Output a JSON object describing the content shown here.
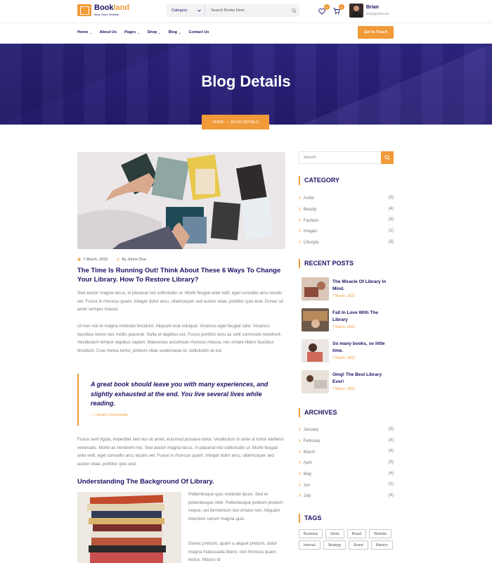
{
  "header": {
    "logo_name_a": "Book",
    "logo_name_b": "land",
    "logo_tagline": "Book Store Website",
    "category_label": "Category",
    "search_placeholder": "Search Books Here",
    "wishlist_count": "0",
    "cart_count": "0",
    "user_name": "Brian",
    "user_email": "info@gmail.com"
  },
  "nav": {
    "items": [
      "Home",
      "About Us",
      "Pages",
      "Shop",
      "Blog",
      "Contact Us"
    ],
    "cta_label": "Get In Touch"
  },
  "hero": {
    "title": "Blog Details",
    "crumb_home": "HOME",
    "crumb_sep": "•",
    "crumb_current": "BLOG DETAILS"
  },
  "post": {
    "date": "7 March, 2022",
    "author": "By Johne Doe",
    "title": "The Time Is Running Out! Think About These 6 Ways To Change Your Library. How To Restore Library?",
    "para1": "Sed auctor magna lacus, in placerat nisl sollicitudin ut. Morbi feugiat ante velit, eget convallis arcu iaculis vel. Fusce in rhoncus quam. Integer dolor arcu, ullamcorper sed auctor vitae, porttitor quis erat. Donec sit amet semper massa.",
    "para2": "Ut non nisl et magna molestie tincidunt. Aliquam erat volutpat. Vivamus eget feugiat odio. Vivamus faucibus lorem nec mollis placerat. Nulla et dapibus est. Fusce porttitor arcu ac velit commodo hendrerit. Vestibulum tempor dapibus sapien. Maecenas accumsan rhoncus massa, nec ornare libero faucibus tincidunt. Cras metus tortor, pretium vitae scelerisque id, sollicitudin at est.",
    "quote": "A great book should leave you with many experiences, and slightly exhausted at the end. You live several lives while reading.",
    "quote_author": "Library Community",
    "para3": "Fusce sem ligula, imperdiet sed nisi sit amet, euismod posuere dolor. Vestibulum in ante ut tortor eleifend venenatis. Morbi ac hendrerit nisl. Sed auctor magna lacus, in placerat nisl sollicitudin ut. Morbi feugiat ante velit, eget convallis arcu iaculis vel. Fusce in rhoncus quam. Integer dolor arcu, ullamcorper sed auctor vitae, porttitor quis erat.",
    "subheading": "Understanding The Background Of Library.",
    "side_para1": "Pellentesque quis molestie lacus. Sed et pellentesque nibh. Pellentesque pretium pretium neque, vel fermentum nisl ornare non. Aliquam interdum rutrum magna quis.",
    "side_para2": "Donec pretium, quam a aliquet pretium, dolor magna malesuada libero, non rhoncus quam lectus. Mauris id"
  },
  "sidebar": {
    "search_placeholder": "Search",
    "category_title": "CATEGORY",
    "categories": [
      {
        "label": "Audio",
        "count": "(3)"
      },
      {
        "label": "Beauty",
        "count": "(4)"
      },
      {
        "label": "Fashion",
        "count": "(3)"
      },
      {
        "label": "Images",
        "count": "(1)"
      },
      {
        "label": "Lifestyle",
        "count": "(3)"
      }
    ],
    "recent_title": "RECENT POSTS",
    "recent_posts": [
      {
        "title": "The Miracle Of Library In Mind.",
        "date": "7 March, 2022"
      },
      {
        "title": "Fall In Love With The Library",
        "date": "7 March, 2022"
      },
      {
        "title": "So many books, so little time.",
        "date": "7 March, 2022"
      },
      {
        "title": "Omg! The Best Library Ever!",
        "date": "7 March, 2022"
      }
    ],
    "archives_title": "ARCHIVES",
    "archives": [
      {
        "label": "January",
        "count": "(3)"
      },
      {
        "label": "February",
        "count": "(4)"
      },
      {
        "label": "March",
        "count": "(4)"
      },
      {
        "label": "April",
        "count": "(3)"
      },
      {
        "label": "May",
        "count": "(4)"
      },
      {
        "label": "Jun",
        "count": "(1)"
      },
      {
        "label": "July",
        "count": "(4)"
      }
    ],
    "tags_title": "TAGS",
    "tags": [
      "Business",
      "News",
      "Brand",
      "Website",
      "Internal",
      "Strategy",
      "Brand",
      "Mission"
    ]
  },
  "colors": {
    "accent": "#f19a38",
    "navy": "#1b1464",
    "hero": "#2b1f7a"
  }
}
